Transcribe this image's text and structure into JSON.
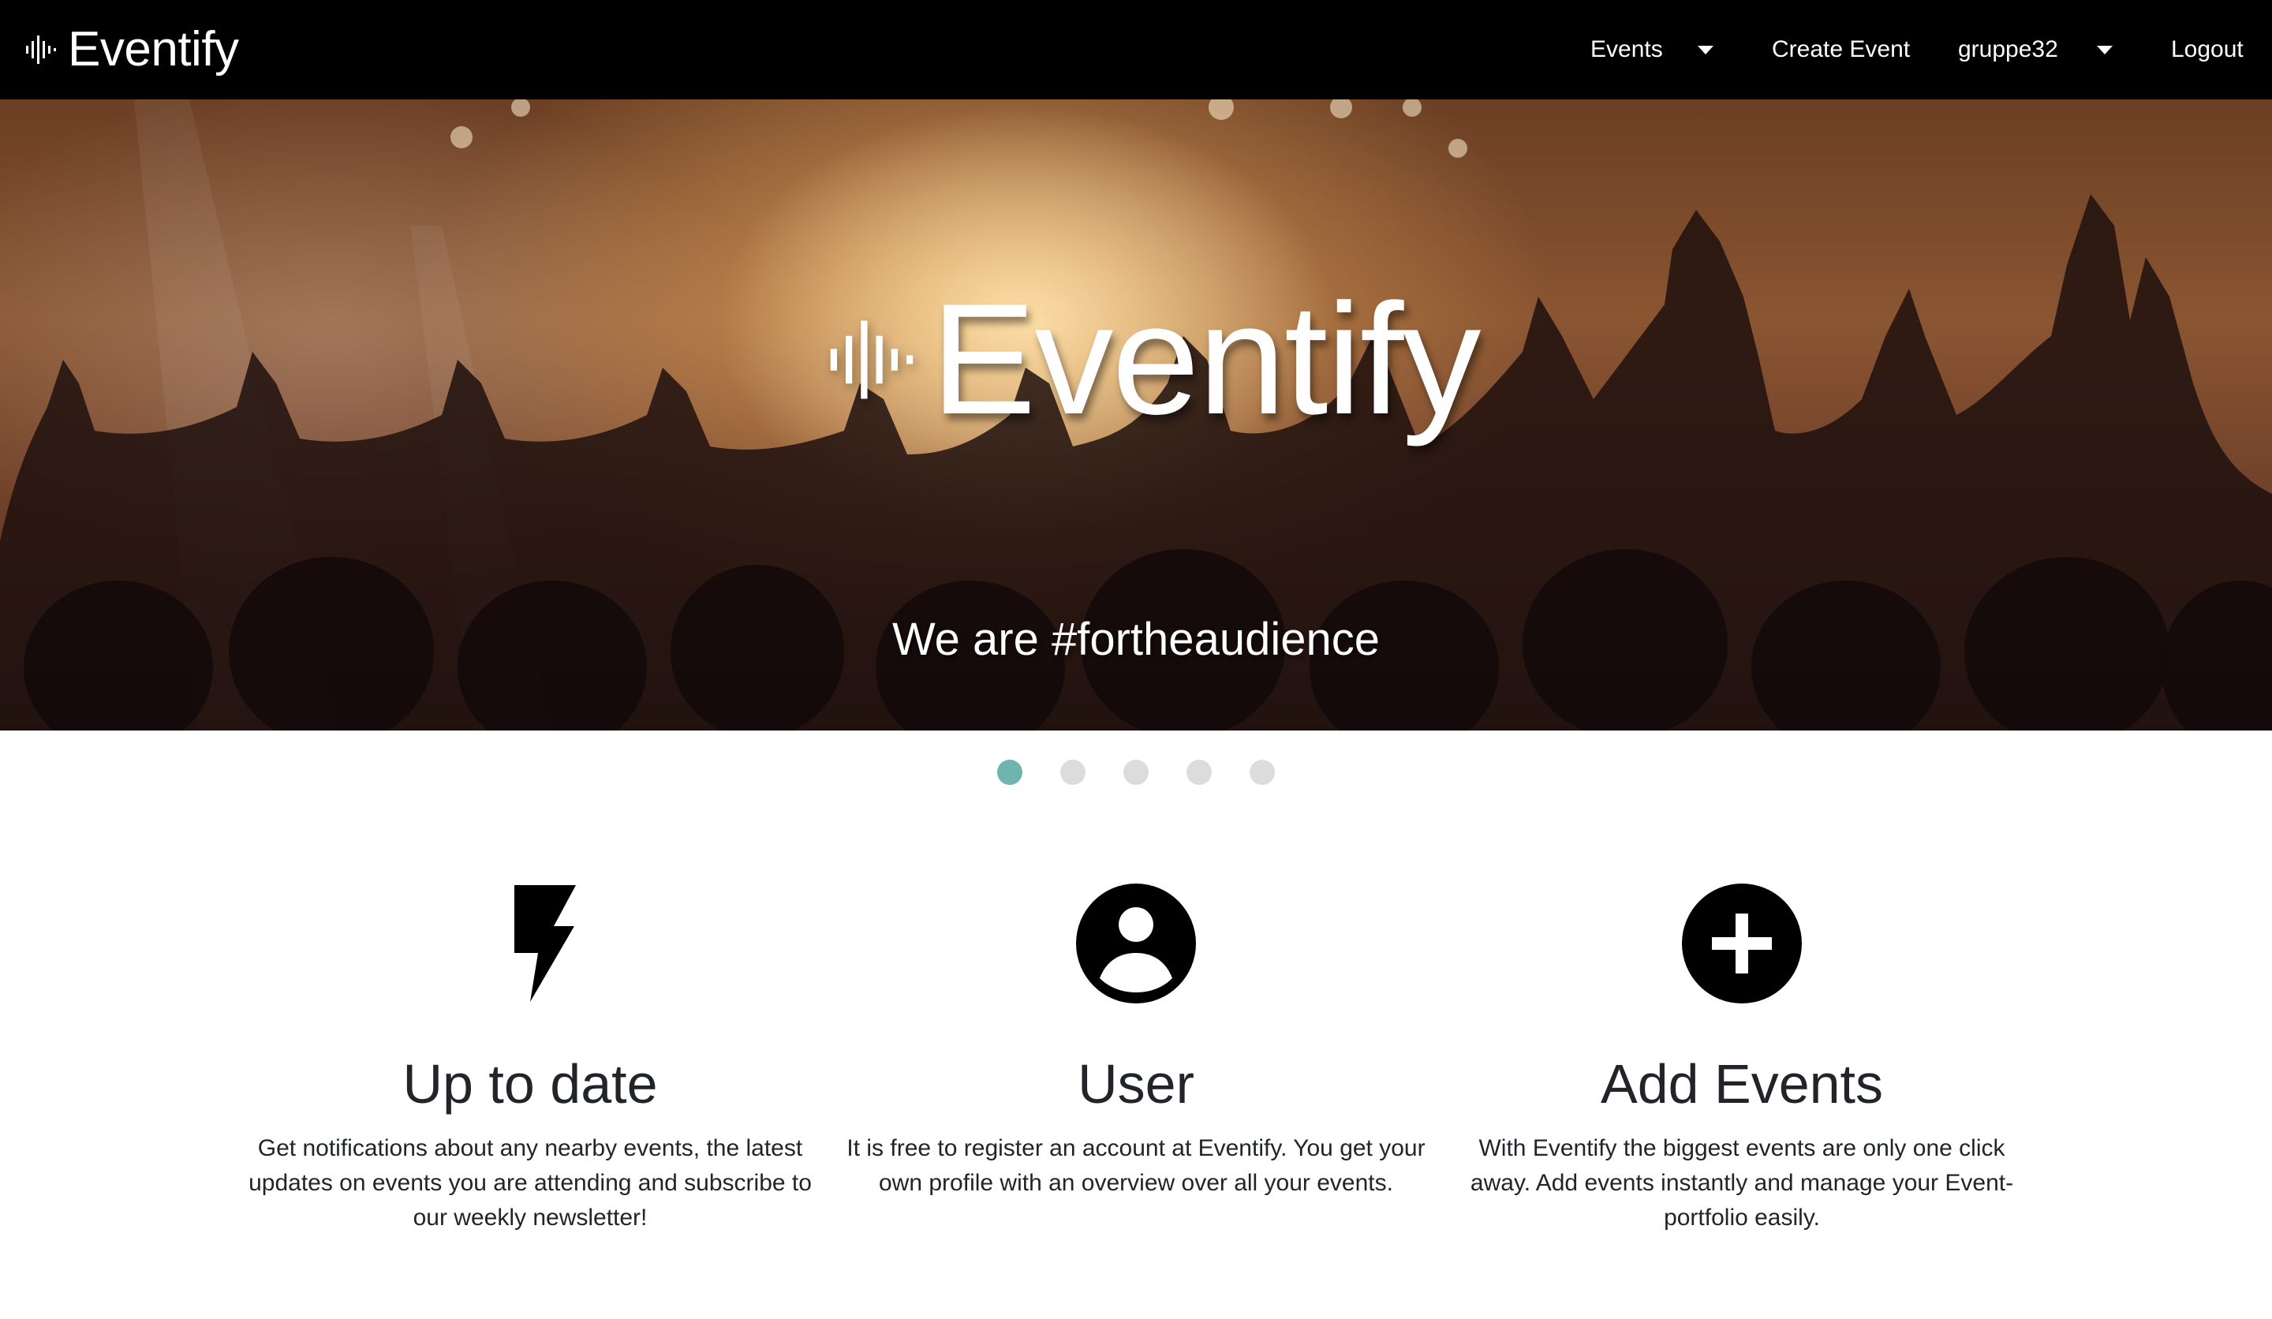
{
  "navbar": {
    "brand": "Eventify",
    "items": {
      "events": "Events",
      "create_event": "Create Event",
      "user": "gruppe32",
      "logout": "Logout"
    }
  },
  "hero": {
    "title": "Eventify",
    "caption": "We are #fortheaudience",
    "carousel": {
      "slide_count": 5,
      "active_index": 0,
      "active_color": "#6fb4ad",
      "inactive_color": "#dcdcdc"
    }
  },
  "features": [
    {
      "icon": "lightning-icon",
      "title": "Up to date",
      "text": "Get notifications about any nearby events, the latest updates on events you are attending and subscribe to our weekly newsletter!"
    },
    {
      "icon": "user-circle-icon",
      "title": "User",
      "text": "It is free to register an account at Eventify. You get your own profile with an overview over all your events."
    },
    {
      "icon": "plus-circle-icon",
      "title": "Add Events",
      "text": "With Eventify the biggest events are only one click away. Add events instantly and manage your Event-portfolio easily."
    }
  ],
  "colors": {
    "navbar": "#000000",
    "text": "#212529"
  }
}
